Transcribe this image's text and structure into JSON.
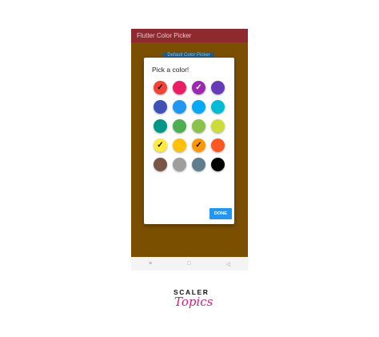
{
  "app": {
    "title": "Flutter Color Picker",
    "background_button_label": "Default Color Picker",
    "background_color": "#7a4f00"
  },
  "dialog": {
    "title": "Pick a color!",
    "done_label": "DONE",
    "swatches": [
      {
        "color": "#f44336",
        "selected": true,
        "check": "✓",
        "check_color": "#000000"
      },
      {
        "color": "#e91e63",
        "selected": false,
        "check": "",
        "check_color": "#ffffff"
      },
      {
        "color": "#9c27b0",
        "selected": true,
        "check": "✓",
        "check_color": "#ffffff"
      },
      {
        "color": "#673ab7",
        "selected": false,
        "check": "",
        "check_color": "#ffffff"
      },
      {
        "color": "#3f51b5",
        "selected": false,
        "check": "",
        "check_color": "#ffffff"
      },
      {
        "color": "#2196f3",
        "selected": false,
        "check": "",
        "check_color": "#ffffff"
      },
      {
        "color": "#03a9f4",
        "selected": false,
        "check": "",
        "check_color": "#ffffff"
      },
      {
        "color": "#00bcd4",
        "selected": false,
        "check": "",
        "check_color": "#ffffff"
      },
      {
        "color": "#009688",
        "selected": false,
        "check": "",
        "check_color": "#ffffff"
      },
      {
        "color": "#4caf50",
        "selected": false,
        "check": "",
        "check_color": "#ffffff"
      },
      {
        "color": "#8bc34a",
        "selected": false,
        "check": "",
        "check_color": "#ffffff"
      },
      {
        "color": "#cddc39",
        "selected": false,
        "check": "",
        "check_color": "#ffffff"
      },
      {
        "color": "#ffeb3b",
        "selected": true,
        "check": "✓",
        "check_color": "#000000"
      },
      {
        "color": "#ffc107",
        "selected": false,
        "check": "",
        "check_color": "#ffffff"
      },
      {
        "color": "#ff9800",
        "selected": true,
        "check": "✓",
        "check_color": "#000000"
      },
      {
        "color": "#ff5722",
        "selected": false,
        "check": "",
        "check_color": "#ffffff"
      },
      {
        "color": "#795548",
        "selected": false,
        "check": "",
        "check_color": "#ffffff"
      },
      {
        "color": "#9e9e9e",
        "selected": false,
        "check": "",
        "check_color": "#ffffff"
      },
      {
        "color": "#607d8b",
        "selected": false,
        "check": "",
        "check_color": "#ffffff"
      },
      {
        "color": "#000000",
        "selected": false,
        "check": "",
        "check_color": "#ffffff"
      }
    ]
  },
  "nav": {
    "menu_icon": "≡",
    "home_icon": "□",
    "back_icon": "◁"
  },
  "branding": {
    "top": "SCALER",
    "bottom": "Topics"
  }
}
